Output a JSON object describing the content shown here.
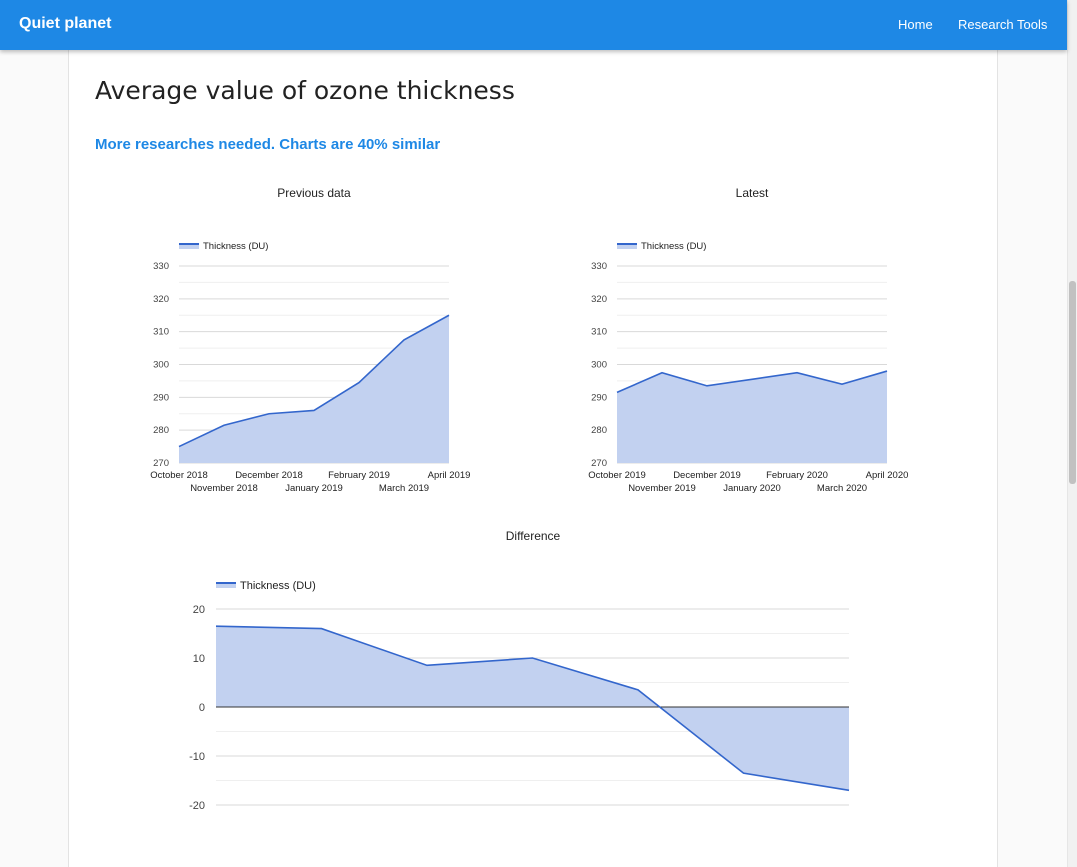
{
  "navbar": {
    "brand": "Quiet planet",
    "links": [
      "Home",
      "Research Tools"
    ]
  },
  "page": {
    "title": "Average value of ozone thickness",
    "status": "More researches needed. Charts are 40% similar"
  },
  "colors": {
    "navbar": "#1e88e5",
    "series_line": "#3366cc",
    "series_fill": "#c2d1f0"
  },
  "chart_data": [
    {
      "type": "area",
      "title": "Previous data",
      "legend": "top-left",
      "series": [
        {
          "name": "Thickness (DU)",
          "values": [
            275,
            281.5,
            285,
            286,
            294.5,
            307.5,
            315
          ]
        }
      ],
      "categories": [
        "October 2018",
        "November 2018",
        "December 2018",
        "January 2019",
        "February 2019",
        "March 2019",
        "April 2019"
      ],
      "ylim": [
        270,
        330
      ],
      "yticks": [
        270,
        280,
        290,
        300,
        310,
        320,
        330
      ]
    },
    {
      "type": "area",
      "title": "Latest",
      "legend": "top-left",
      "series": [
        {
          "name": "Thickness (DU)",
          "values": [
            291.5,
            297.5,
            293.5,
            295.5,
            297.5,
            294,
            298
          ]
        }
      ],
      "categories": [
        "October 2019",
        "November 2019",
        "December 2019",
        "January 2020",
        "February 2020",
        "March 2020",
        "April 2020"
      ],
      "ylim": [
        270,
        330
      ],
      "yticks": [
        270,
        280,
        290,
        300,
        310,
        320,
        330
      ]
    },
    {
      "type": "area",
      "title": "Difference",
      "legend": "top-left",
      "series": [
        {
          "name": "Thickness (DU)",
          "values": [
            16.5,
            16,
            8.5,
            10,
            3.5,
            -13.5,
            -17
          ]
        }
      ],
      "categories": [],
      "ylim": [
        -20,
        20
      ],
      "yticks": [
        -20,
        -10,
        0,
        10,
        20
      ]
    }
  ]
}
